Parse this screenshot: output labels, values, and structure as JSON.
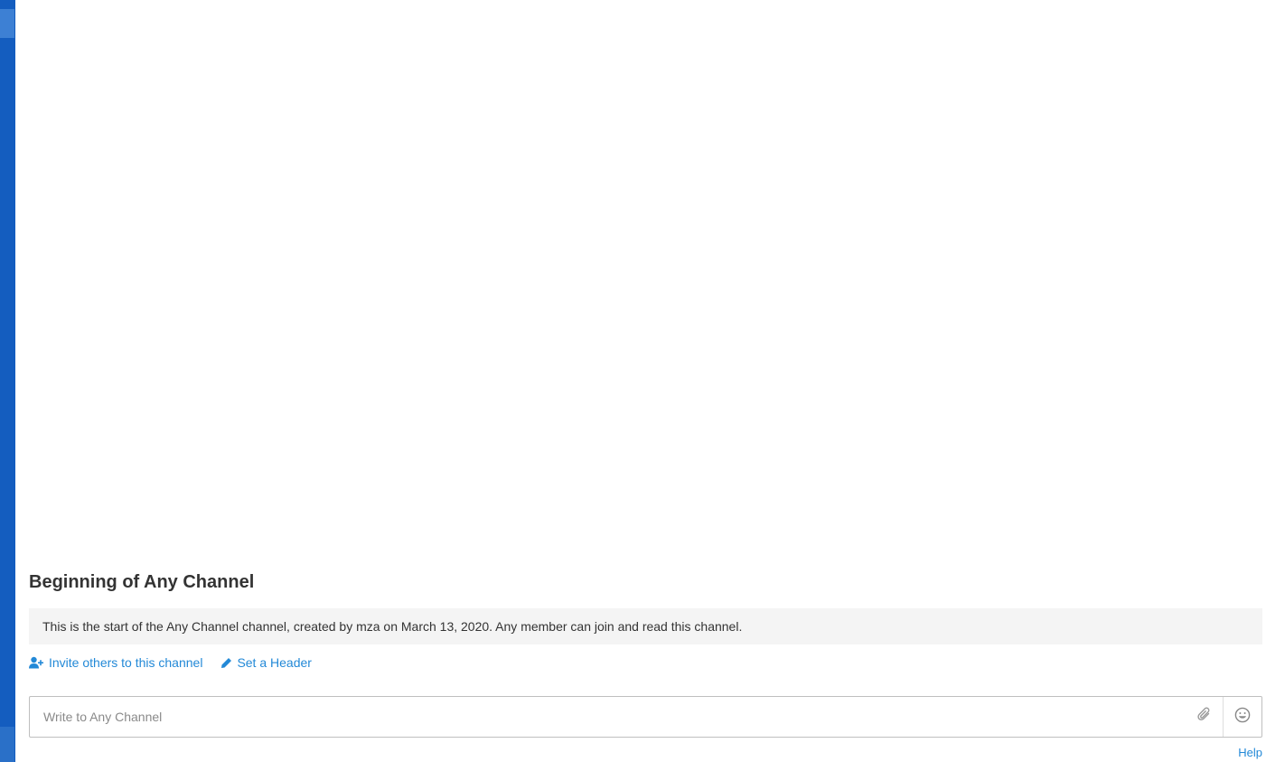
{
  "channel": {
    "intro_title": "Beginning of Any Channel",
    "intro_text": "This is the start of the Any Channel channel, created by mza on March 13, 2020. Any member can join and read this channel.",
    "invite_label": "Invite others to this channel",
    "set_header_label": "Set a Header"
  },
  "composer": {
    "placeholder": "Write to Any Channel",
    "attach_icon": "paperclip-icon",
    "emoji_icon": "smiley-icon"
  },
  "footer": {
    "help_label": "Help"
  },
  "colors": {
    "sidebar": "#145dbf",
    "link": "#2389d7",
    "intro_bg": "#f4f4f4"
  }
}
